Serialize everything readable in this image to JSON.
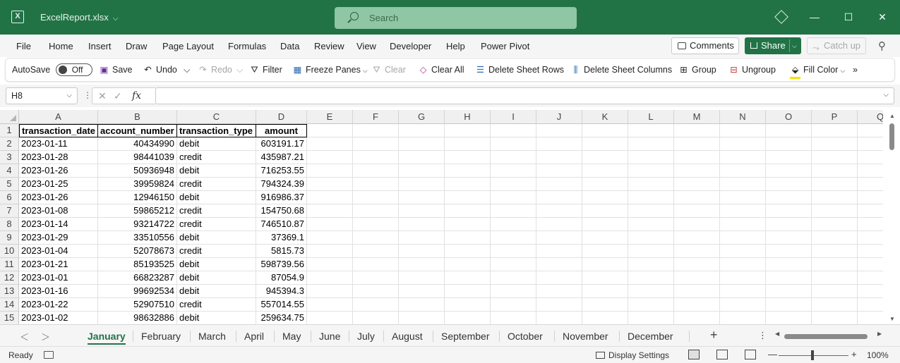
{
  "titlebar": {
    "file_name": "ExcelReport.xlsx",
    "search_placeholder": "Search"
  },
  "menu": {
    "items": [
      "File",
      "Home",
      "Insert",
      "Draw",
      "Page Layout",
      "Formulas",
      "Data",
      "Review",
      "View",
      "Developer",
      "Help",
      "Power Pivot"
    ],
    "comments": "Comments",
    "share": "Share",
    "catch_up": "Catch up"
  },
  "ribbon": {
    "autosave": "AutoSave",
    "autosave_state": "Off",
    "save": "Save",
    "undo": "Undo",
    "redo": "Redo",
    "filter": "Filter",
    "freeze_panes": "Freeze Panes",
    "clear": "Clear",
    "clear_all": "Clear All",
    "delete_sheet_rows": "Delete Sheet Rows",
    "delete_sheet_columns": "Delete Sheet Columns",
    "group": "Group",
    "ungroup": "Ungroup",
    "fill_color": "Fill Color",
    "more": "»"
  },
  "formula_bar": {
    "name_box": "H8",
    "fx": "fx",
    "value": ""
  },
  "grid": {
    "columns": [
      "A",
      "B",
      "C",
      "D",
      "E",
      "F",
      "G",
      "H",
      "I",
      "J",
      "K",
      "L",
      "M",
      "N",
      "O",
      "P",
      "Q"
    ],
    "header_row": [
      "transaction_date",
      "account_number",
      "transaction_type",
      "amount"
    ],
    "rows": [
      [
        "2023-01-11",
        "40434990",
        "debit",
        "603191.17"
      ],
      [
        "2023-01-28",
        "98441039",
        "credit",
        "435987.21"
      ],
      [
        "2023-01-26",
        "50936948",
        "debit",
        "716253.55"
      ],
      [
        "2023-01-25",
        "39959824",
        "credit",
        "794324.39"
      ],
      [
        "2023-01-26",
        "12946150",
        "debit",
        "916986.37"
      ],
      [
        "2023-01-08",
        "59865212",
        "credit",
        "154750.68"
      ],
      [
        "2023-01-14",
        "93214722",
        "credit",
        "746510.87"
      ],
      [
        "2023-01-29",
        "33510556",
        "debit",
        "37369.1"
      ],
      [
        "2023-01-04",
        "52078673",
        "credit",
        "5815.73"
      ],
      [
        "2023-01-21",
        "85193525",
        "debit",
        "598739.56"
      ],
      [
        "2023-01-01",
        "66823287",
        "debit",
        "87054.9"
      ],
      [
        "2023-01-16",
        "99692534",
        "debit",
        "945394.3"
      ],
      [
        "2023-01-22",
        "52907510",
        "credit",
        "557014.55"
      ],
      [
        "2023-01-02",
        "98632886",
        "debit",
        "259634.75"
      ]
    ]
  },
  "sheets": {
    "active": "January",
    "tabs": [
      "January",
      "February",
      "March",
      "April",
      "May",
      "June",
      "July",
      "August",
      "September",
      "October",
      "November",
      "December"
    ]
  },
  "status": {
    "ready": "Ready",
    "display_settings": "Display Settings",
    "zoom": "100%"
  }
}
